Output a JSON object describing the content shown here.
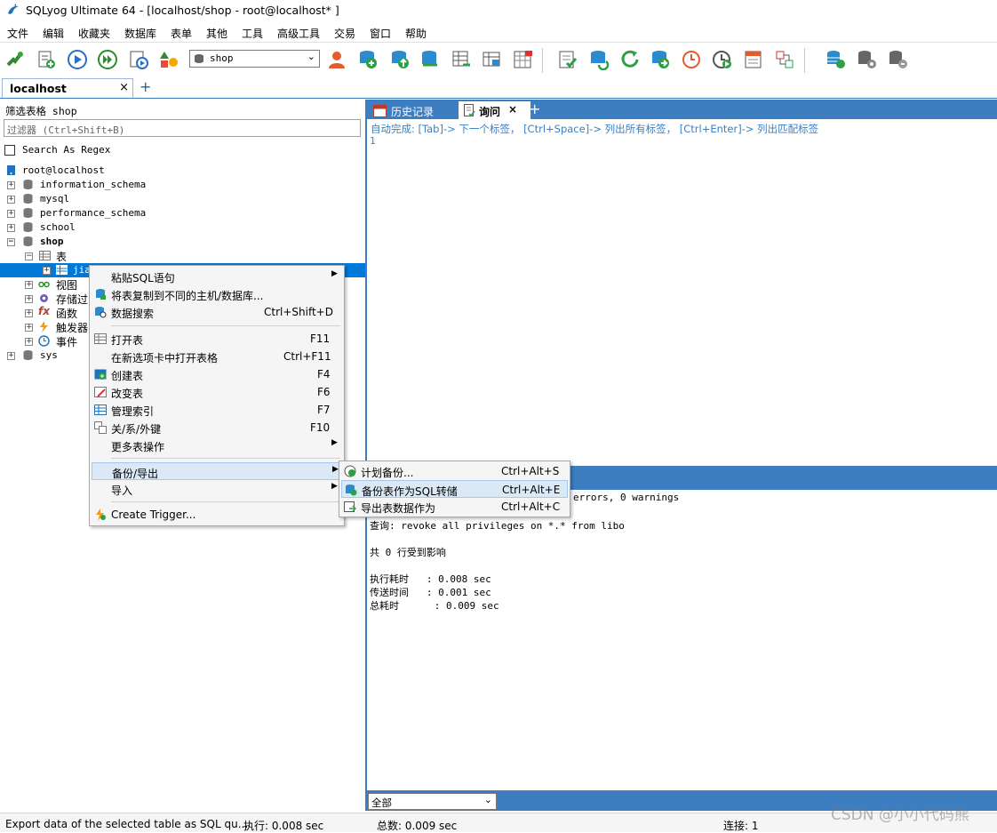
{
  "window": {
    "title": "SQLyog Ultimate 64 - [localhost/shop - root@localhost* ]"
  },
  "menu": [
    "文件",
    "编辑",
    "收藏夹",
    "数据库",
    "表单",
    "其他",
    "工具",
    "高级工具",
    "交易",
    "窗口",
    "帮助"
  ],
  "toolbar": {
    "database_select": "shop"
  },
  "connection_tab": {
    "label": "localhost",
    "close": "×",
    "add": "+"
  },
  "left": {
    "filter_label": "筛选表格 shop",
    "filter_placeholder": "过滤器 (Ctrl+Shift+B)",
    "regex_label": "Search As Regex",
    "tree": {
      "root": "root@localhost",
      "databases": [
        "information_schema",
        "mysql",
        "performance_schema",
        "school",
        "shop"
      ],
      "shop_children": {
        "tables": "表",
        "table_item": "jia",
        "views": "视图",
        "procs": "存储过",
        "funcs": "函数",
        "triggers": "触发器",
        "events": "事件"
      },
      "sys": "sys"
    }
  },
  "right": {
    "tabs": {
      "history": "历史记录",
      "query": "询问",
      "close": "×",
      "add": "+"
    },
    "autocomplete_hint": "自动完成: [Tab]-> 下一个标签， [Ctrl+Space]-> 列出所有标签， [Ctrl+Enter]-> 列出匹配标签",
    "line_number": "1",
    "result_lines": [
      "errors, 0 warnings",
      "查询: revoke all privileges on *.* from libo",
      "共 0 行受到影响",
      "执行耗时   : 0.008 sec",
      "传送时间   : 0.001 sec",
      "总耗时      : 0.009 sec"
    ],
    "result_filter": "全部"
  },
  "context_menu": {
    "items": [
      {
        "label": "粘贴SQL语句",
        "key": "",
        "submenu": true
      },
      {
        "label": "将表复制到不同的主机/数据库...",
        "key": ""
      },
      {
        "label": "数据搜索",
        "key": "Ctrl+Shift+D"
      },
      {
        "label": "打开表",
        "key": "F11"
      },
      {
        "label": "在新选项卡中打开表格",
        "key": "Ctrl+F11"
      },
      {
        "label": "创建表",
        "key": "F4"
      },
      {
        "label": "改变表",
        "key": "F6"
      },
      {
        "label": "管理索引",
        "key": "F7"
      },
      {
        "label": "关/系/外键",
        "key": "F10"
      },
      {
        "label": "更多表操作",
        "key": "",
        "submenu": true
      },
      {
        "label": "备份/导出",
        "key": "",
        "submenu": true
      },
      {
        "label": "导入",
        "key": "",
        "submenu": true
      },
      {
        "label": "Create Trigger...",
        "key": ""
      }
    ]
  },
  "submenu": {
    "items": [
      {
        "label": "计划备份...",
        "key": "Ctrl+Alt+S"
      },
      {
        "label": "备份表作为SQL转储",
        "key": "Ctrl+Alt+E"
      },
      {
        "label": "导出表数据作为",
        "key": "Ctrl+Alt+C"
      }
    ]
  },
  "status": {
    "message": "Export data of the selected table as SQL qu...",
    "exec_time": "执行: 0.008 sec",
    "total": "总数: 0.009 sec",
    "connections": "连接: 1"
  },
  "watermark": "CSDN @小小代码熊",
  "colors": {
    "accent": "#3d7ec1",
    "selection": "#0078d7",
    "hint": "#3b7fc4"
  }
}
